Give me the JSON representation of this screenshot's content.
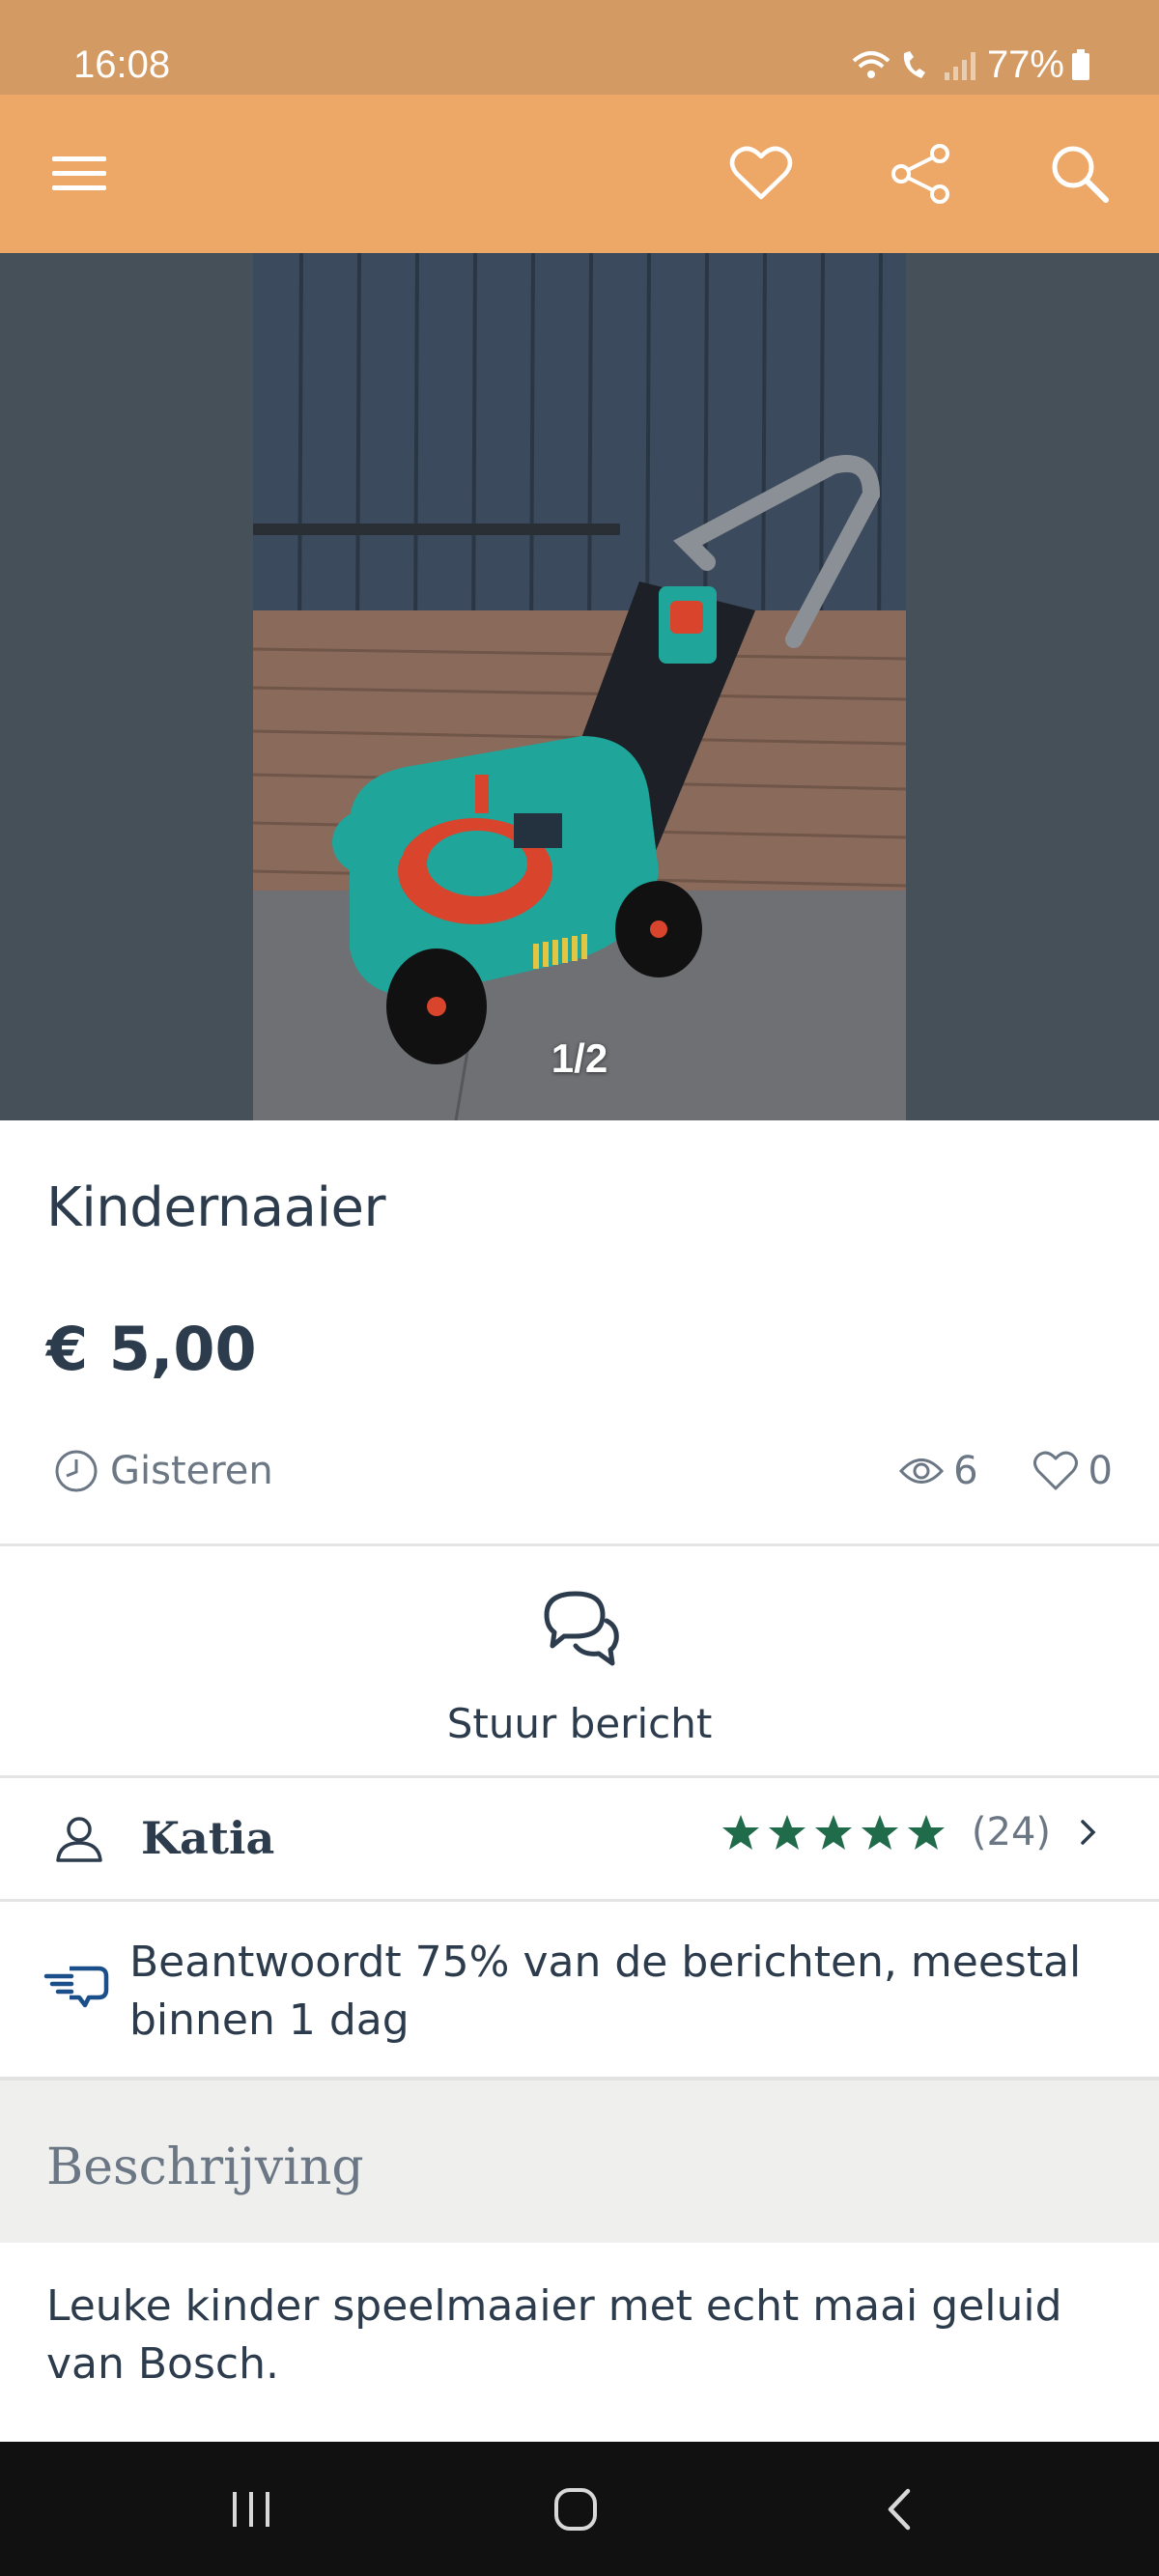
{
  "status_bar": {
    "time": "16:08",
    "battery": "77%",
    "icons": [
      "wifi-icon",
      "wifi-calling-icon",
      "signal-icon",
      "battery-icon"
    ]
  },
  "app_bar": {
    "icons": [
      "menu-icon",
      "heart-icon",
      "share-icon",
      "search-icon"
    ],
    "background_color": "#eda767"
  },
  "gallery": {
    "counter": "1/2"
  },
  "listing": {
    "title": "Kindernaaier",
    "price": "€ 5,00",
    "date": "Gisteren",
    "views": "6",
    "favorites": "0"
  },
  "actions": {
    "message_label": "Stuur bericht"
  },
  "seller": {
    "name": "Katia",
    "rating_stars": 5,
    "rating_count": "(24)",
    "star_color": "#1f6b4a"
  },
  "response": {
    "text": "Beantwoordt 75% van de berichten, meestal binnen 1 dag"
  },
  "description": {
    "header": "Beschrijving",
    "body": "Leuke kinder speelmaaier met echt maai geluid van Bosch."
  },
  "nav_bar": {
    "icons": [
      "recent-apps-icon",
      "home-icon",
      "back-icon"
    ]
  }
}
